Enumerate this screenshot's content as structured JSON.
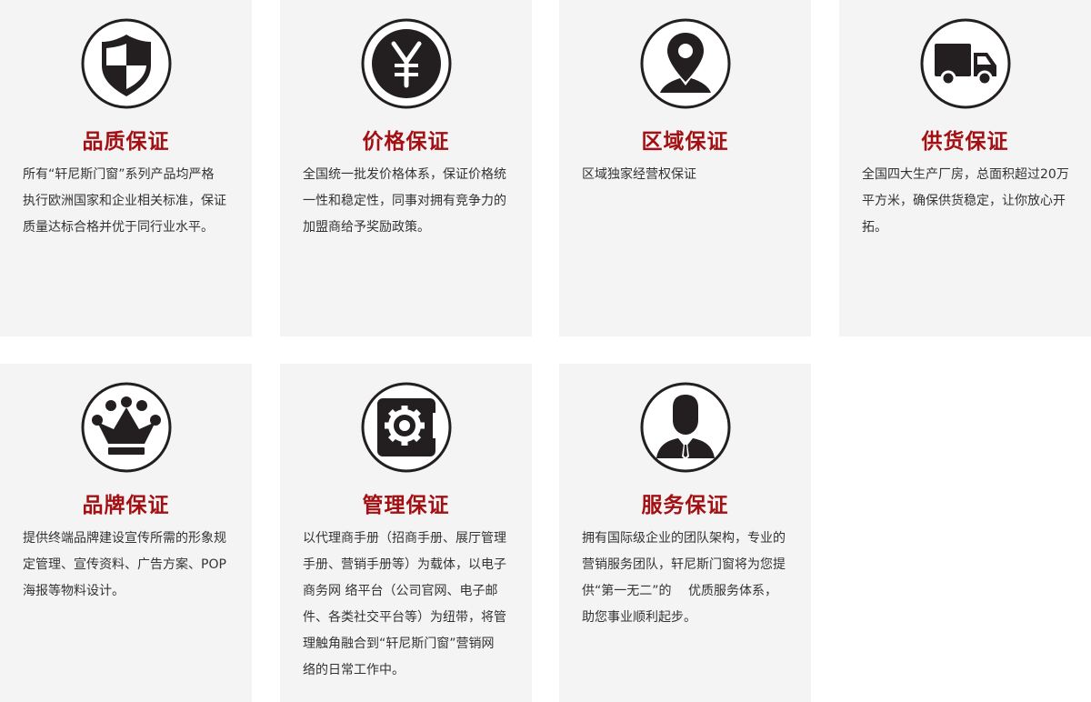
{
  "colors": {
    "title": "#a30f12",
    "card_bg": "#f4f4f4",
    "icon": "#231f20",
    "text": "#333333"
  },
  "cards": [
    {
      "icon": "shield-icon",
      "title": "品质保证",
      "desc": "所有“轩尼斯门窗”系列产品均严格\n执行欧洲国家和企业相关标准，保证\n质量达标合格并优于同行业水平。"
    },
    {
      "icon": "yuan-icon",
      "title": "价格保证",
      "desc": "全国统一批发价格体系，保证价格统\n一性和稳定性，同事对拥有竞争力的\n加盟商给予奖励政策。"
    },
    {
      "icon": "location-pin-icon",
      "title": "区域保证",
      "desc": "区域独家经营权保证"
    },
    {
      "icon": "truck-icon",
      "title": "供货保证",
      "desc": "全国四大生产厂房，总面积超过20万\n平方米，确保供货稳定，让你放心开\n拓。"
    },
    {
      "icon": "crown-icon",
      "title": "品牌保证",
      "desc": "提供终端品牌建设宣传所需的形象规\n定管理、宣传资料、广告方案、POP\n海报等物料设计。"
    },
    {
      "icon": "gear-safe-icon",
      "title": "管理保证",
      "desc": "以代理商手册（招商手册、展厅管理\n手册、营销手册等）为载体，以电子\n商务网 络平台（公司官网、电子邮\n件、各类社交平台等）为纽带，将管\n理触角融合到“轩尼斯门窗”营销网\n络的日常工作中。"
    },
    {
      "icon": "businessman-icon",
      "title": "服务保证",
      "desc": "拥有国际级企业的团队架构，专业的\n营销服务团队，轩尼斯门窗将为您提\n供“第一无二”的　 优质服务体系，\n助您事业顺利起步。"
    }
  ]
}
